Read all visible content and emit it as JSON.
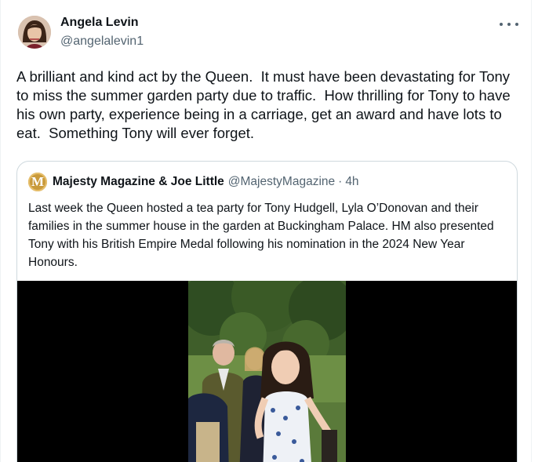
{
  "author": {
    "name": "Angela Levin",
    "handle": "@angelalevin1"
  },
  "more_icon": "more-horizontal-icon",
  "tweet_text": "A brilliant and kind act by the Queen.  It must have been devastating for Tony to miss the summer garden party due to traffic.  How thrilling for Tony to have his own party, experience being in a carriage, get an award and have lots to eat.  Something Tony will ever forget.",
  "quoted": {
    "logo_letter": "M",
    "name": "Majesty Magazine & Joe Little",
    "handle": "@MajestyMagazine",
    "separator": "·",
    "time": "4h",
    "text": "Last week the Queen hosted a tea party for Tony Hudgell, Lyla O’Donovan and their families in the summer house in the garden at Buckingham Palace. HM also presented Tony with his British Empire Medal following his nomination in the 2024 New Year Honours."
  },
  "colors": {
    "text": "#0f1419",
    "secondary": "#536471",
    "border": "#cfd9de",
    "logo": "#c99a3b"
  }
}
